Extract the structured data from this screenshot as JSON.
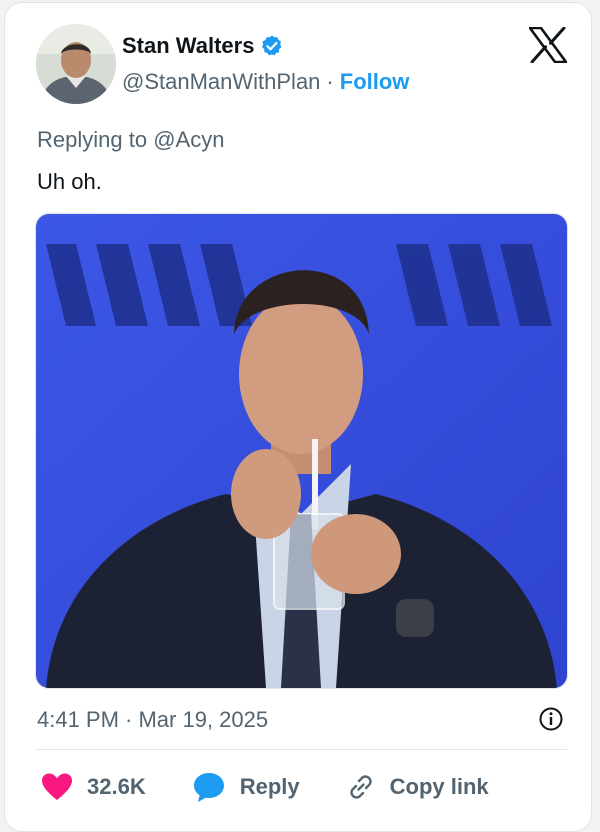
{
  "author": {
    "name": "Stan Walters",
    "handle": "@StanManWithPlan",
    "separator": "·",
    "follow_label": "Follow"
  },
  "tweet": {
    "reply_prefix": "Replying to",
    "reply_mention": "@Acyn",
    "text": "Uh oh.",
    "timestamp": "4:41 PM · Mar 19, 2025"
  },
  "actions": {
    "likes": "32.6K",
    "reply_label": "Reply",
    "copy_link_label": "Copy link"
  },
  "icons": {
    "verified": "verified-badge-icon",
    "brand": "x-logo-icon",
    "info": "info-icon",
    "like": "heart-icon",
    "reply": "speech-bubble-icon",
    "copy_link": "link-icon"
  },
  "colors": {
    "accent": "#1d9bf0",
    "like": "#f91880",
    "text_primary": "#0f1419",
    "text_secondary": "#536471"
  }
}
